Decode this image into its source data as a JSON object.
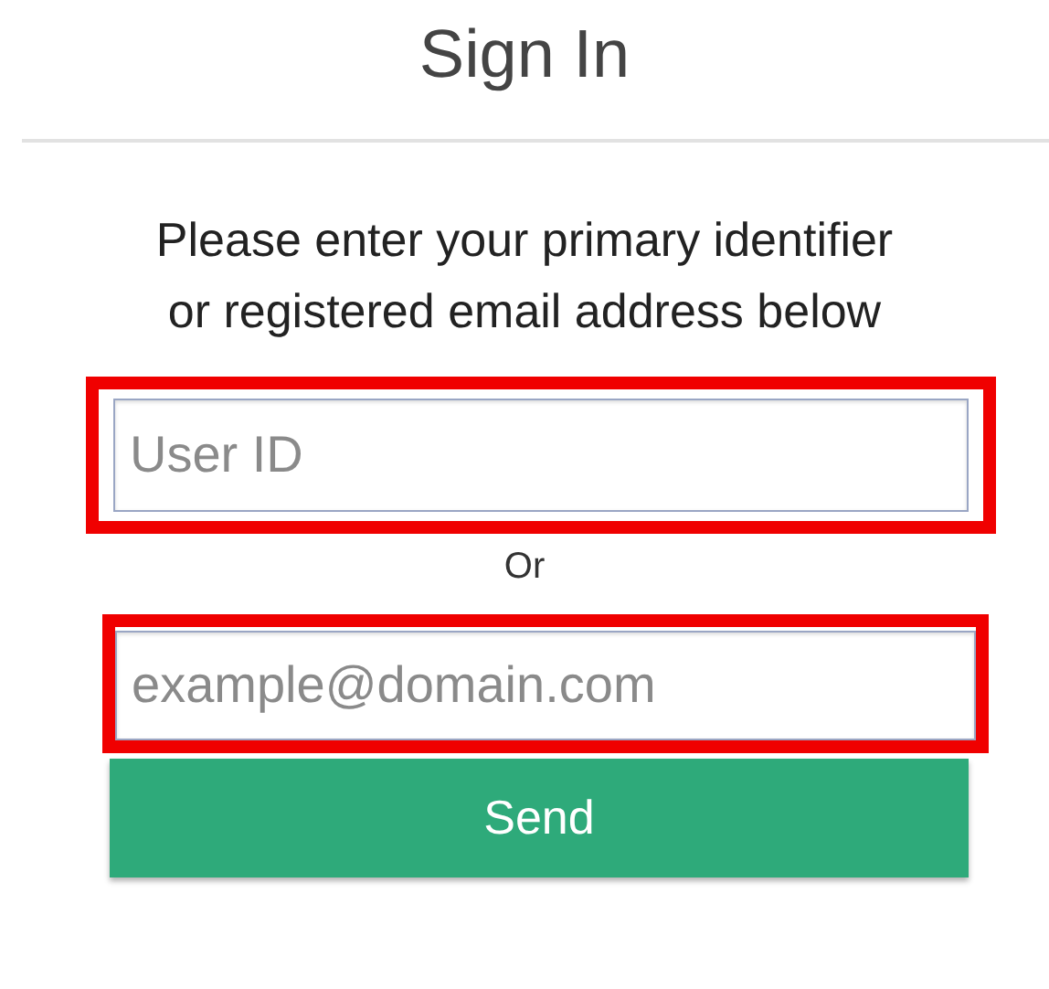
{
  "title": "Sign In",
  "instructions": "Please enter your primary identifier or registered email address below",
  "fields": [
    {
      "placeholder": "User ID",
      "highlighted": true
    },
    {
      "placeholder": "example@domain.com",
      "highlighted": true
    }
  ],
  "separator": "Or",
  "button": "Send"
}
